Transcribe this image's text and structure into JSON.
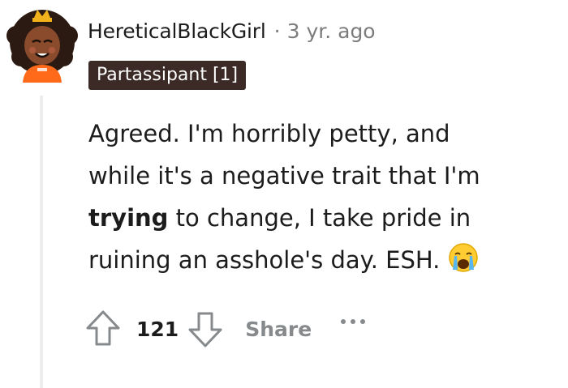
{
  "comment": {
    "username": "HereticalBlackGirl",
    "separator": "·",
    "timestamp": "3 yr. ago",
    "flair": "Partassipant [1]",
    "body": {
      "line1": "Agreed. I'm horribly petty, and",
      "line2": "while it's a negative trait that I'm",
      "line3_bold": "trying",
      "line3_rest": " to change, I take pride in",
      "line4": "ruining an asshole's day. ESH."
    },
    "emoji_icon": "crying-face-icon",
    "actions": {
      "upvote_icon": "upvote-arrow-icon",
      "score": "121",
      "downvote_icon": "downvote-arrow-icon",
      "share_label": "Share",
      "more_icon": "more-options-icon"
    }
  },
  "colors": {
    "flair_bg": "#3b2a25",
    "muted": "#878a8c",
    "thread_line": "#ededed"
  }
}
